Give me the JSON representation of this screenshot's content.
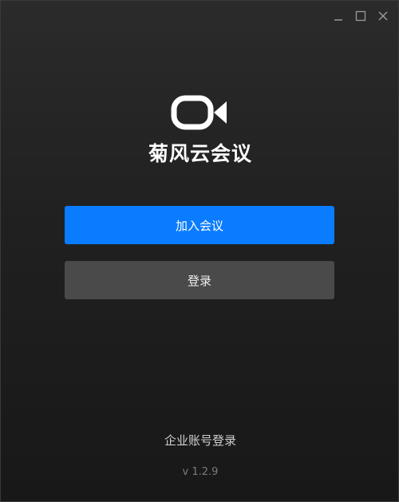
{
  "window": {
    "controls": {
      "minimize_icon": "minimize-icon",
      "maximize_icon": "maximize-icon",
      "close_icon": "close-icon"
    }
  },
  "branding": {
    "logo_icon": "video-camera-icon",
    "app_name": "菊风云会议"
  },
  "actions": {
    "join_meeting_label": "加入会议",
    "login_label": "登录"
  },
  "footer": {
    "enterprise_login_label": "企业账号登录",
    "version": "v 1.2.9"
  },
  "colors": {
    "primary": "#0a7cff",
    "secondary": "#4a4a4a",
    "background": "#1a1a1a",
    "text": "#ffffff"
  }
}
